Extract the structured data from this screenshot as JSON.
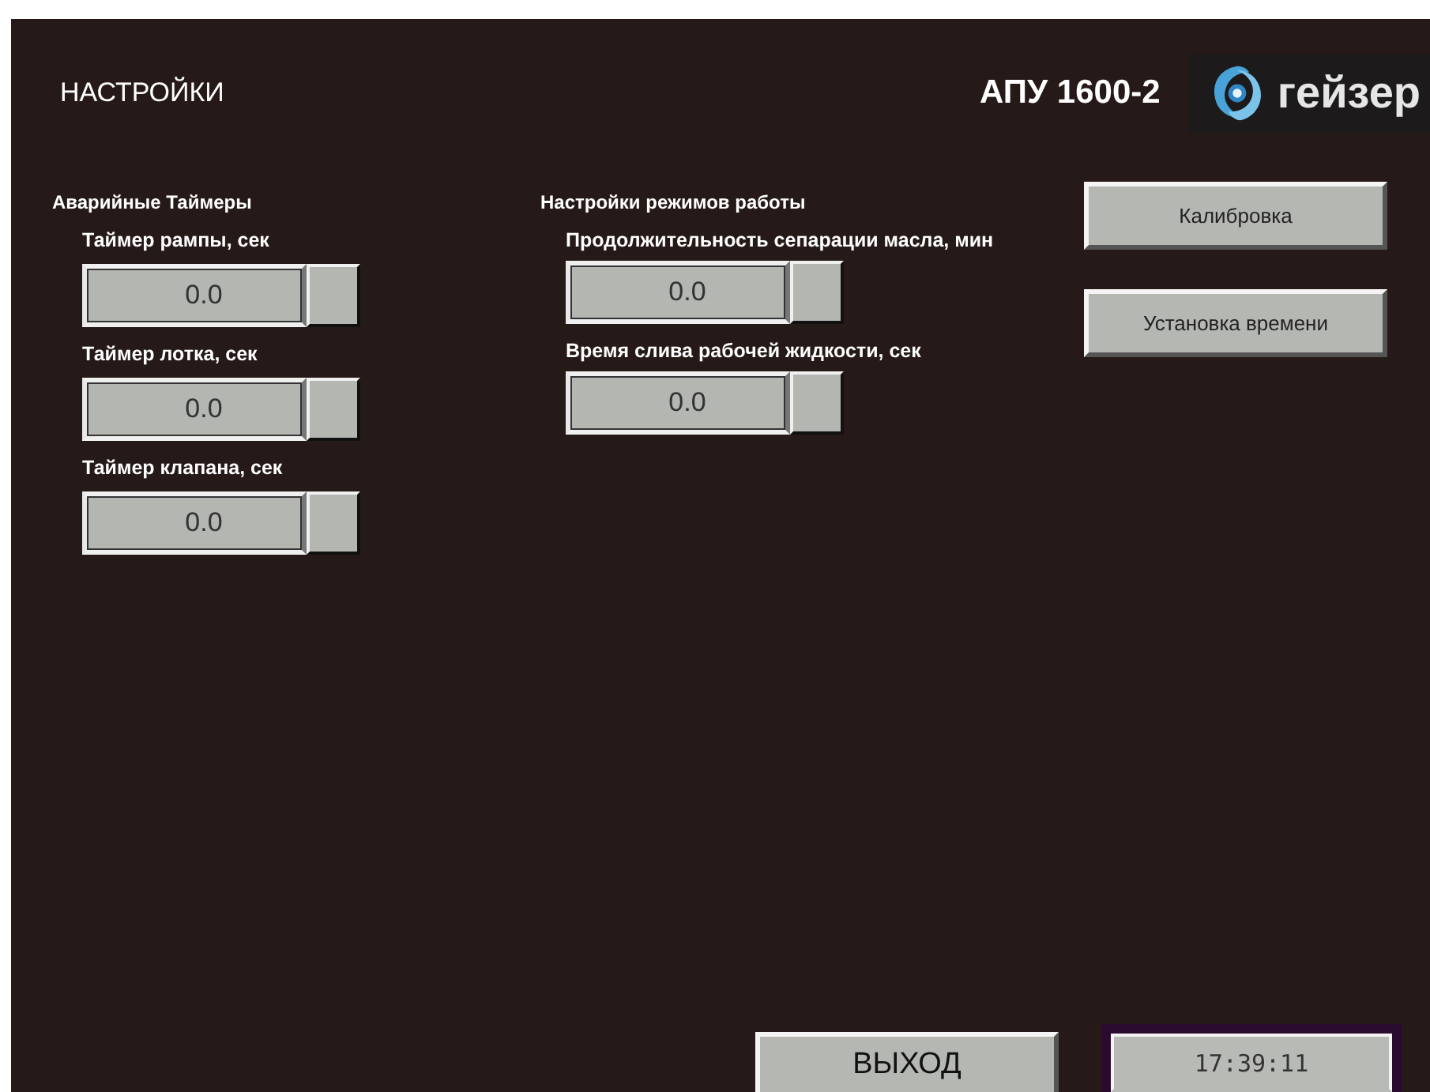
{
  "header": {
    "title": "НАСТРОЙКИ",
    "model": "АПУ 1600-2",
    "logo_text": "гейзер"
  },
  "groups": [
    {
      "heading": "Аварийные Таймеры",
      "fields": [
        {
          "label": "Таймер рампы, сек",
          "value": "0.0"
        },
        {
          "label": "Таймер лотка, сек",
          "value": "0.0"
        },
        {
          "label": "Таймер клапана, сек",
          "value": "0.0"
        }
      ]
    },
    {
      "heading": "Настройки режимов работы",
      "fields": [
        {
          "label": "Продолжительность сепарации масла, мин",
          "value": "0.0"
        },
        {
          "label": "Время слива рабочей жидкости, сек",
          "value": "0.0"
        }
      ]
    }
  ],
  "buttons": [
    "Калибровка",
    "Установка времени"
  ],
  "footer": {
    "exit_button": "ВЫХОД",
    "clock": "17:39:11"
  }
}
